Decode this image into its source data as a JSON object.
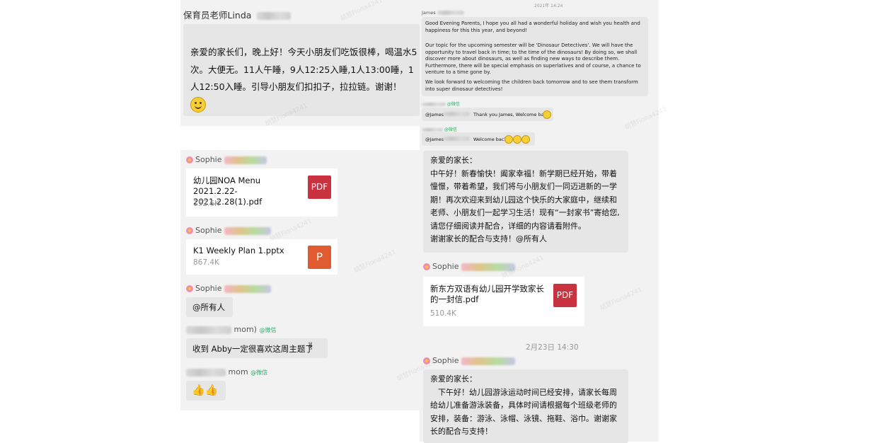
{
  "left": {
    "header_name": "保育员老师Linda",
    "message1": "亲爱的家长们，晚上好！今天小朋友们吃饭很棒，喝温水5次。大便无。11人午睡，9人12:25入睡,1人13:00睡，1人12:50入睡。引导小朋友们扣扣子，拉拉链。谢谢！",
    "sender_sophie": "Sophie",
    "file1": {
      "title": "幼儿园NOA Menu 2021.2.22-2021.2.28(1).pdf",
      "size": "152.6K",
      "icon": "PDF"
    },
    "file2": {
      "title": "K1 Weekly Plan 1.pptx",
      "size": "867.4K",
      "icon": "P"
    },
    "mention_all": "@所有人",
    "sender_mom1": "mom)",
    "wechat_tag": "@微信",
    "message_abby": "收到 Abby一定很喜欢这周主题了",
    "sender_mom2": "mom"
  },
  "right": {
    "timestamp_top": "2021年 14:24",
    "sender_james": "James",
    "english_p1": "Good Evening Parents, I hope you all had a wonderful holiday and wish you health and happiness for this this year, and beyond!",
    "english_p2": "Our topic for the upcoming semester will be 'Dinosaur Detectives'. We will have the opportunity to travel back in time; to the time of the dinosaurs! By doing so, we shall discover more about dinosaurs, as well as finding new ways to describe them. Furthermore, there will be special emphasis on superlatives and of course, a chance to venture to a time gone by.",
    "english_p3": "We look forward to welcoming the children back tomorrow and to see them transform into super dinosaur detectives!",
    "reply1_tag": "@微信",
    "reply1_prefix": "@James",
    "reply1_text": "Thank you James, Welcome back",
    "reply2_tag": "@微信",
    "reply2_prefix": "@James",
    "reply2_text": "Welcome back",
    "cn_letter": {
      "greeting": "亲爱的家长：",
      "body": "中午好！新春愉快！阖家幸福！新学期已经开始，带着憧憬，带着希望，我们将与小朋友们一同迈进新的一学期！再次欢迎来到幼儿园这个快乐的大家庭中，继续和老师、小朋友们一起学习生活！现有“一封家书”寄给您,请您仔细阅读并配合，详细的内容请看附件。",
      "closing": "谢谢家长的配合与支持！@所有人"
    },
    "sender_sophie": "Sophie",
    "file3": {
      "title": "新东方双语有幼儿园开学致家长的一封信.pdf",
      "size": "510.4K",
      "icon": "PDF"
    },
    "timestamp_mid": "2月23日 14:30",
    "swim_msg": {
      "greeting": "亲爱的家长：",
      "body": "下午好！幼儿园游泳运动时间已经安排，请家长每周给幼儿准备游泳装备，具体时间请根据每个班级老师的安排，装备：游泳、泳帽、泳镜、拖鞋、浴巾。谢谢家长的配合与支持！"
    }
  },
  "watermark_text": "胡慧Fiona4241"
}
